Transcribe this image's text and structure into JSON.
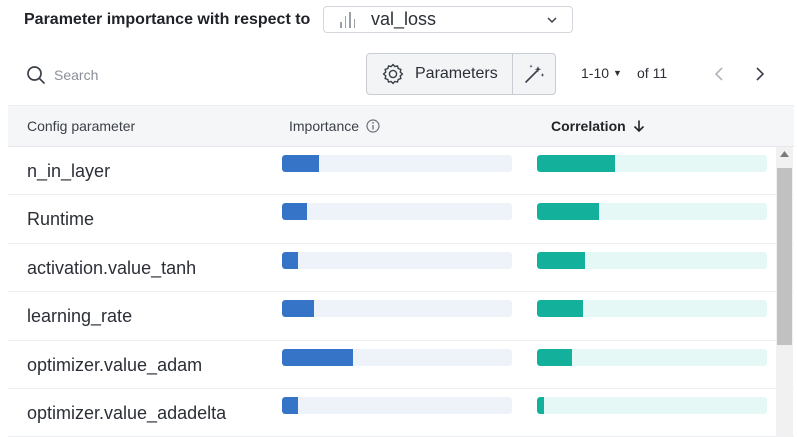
{
  "header": {
    "label": "Parameter importance with respect to",
    "metric": "val_loss"
  },
  "toolbar": {
    "search_placeholder": "Search",
    "parameters_label": "Parameters",
    "page_range": "1-10",
    "page_total": "of 11"
  },
  "table": {
    "columns": {
      "param": "Config parameter",
      "importance": "Importance",
      "correlation": "Correlation"
    },
    "sort": "correlation-desc",
    "rows": [
      {
        "name": "n_in_layer",
        "importance": 0.16,
        "correlation": 0.34
      },
      {
        "name": "Runtime",
        "importance": 0.11,
        "correlation": 0.27
      },
      {
        "name": "activation.value_tanh",
        "importance": 0.07,
        "correlation": 0.21
      },
      {
        "name": "learning_rate",
        "importance": 0.14,
        "correlation": 0.2
      },
      {
        "name": "optimizer.value_adam",
        "importance": 0.31,
        "correlation": 0.15
      },
      {
        "name": "optimizer.value_adadelta",
        "importance": 0.07,
        "correlation": 0.03
      }
    ]
  },
  "colors": {
    "importance_fill": "#3574c7",
    "importance_track": "#eef2f9",
    "correlation_fill": "#13b09b",
    "correlation_track": "#e6f8f5"
  },
  "icons": {
    "metric": "bar-chart-icon",
    "search": "search-icon",
    "parameters": "gear-icon",
    "magic": "magic-wand-icon",
    "info": "info-icon",
    "sort": "arrow-down-icon"
  }
}
